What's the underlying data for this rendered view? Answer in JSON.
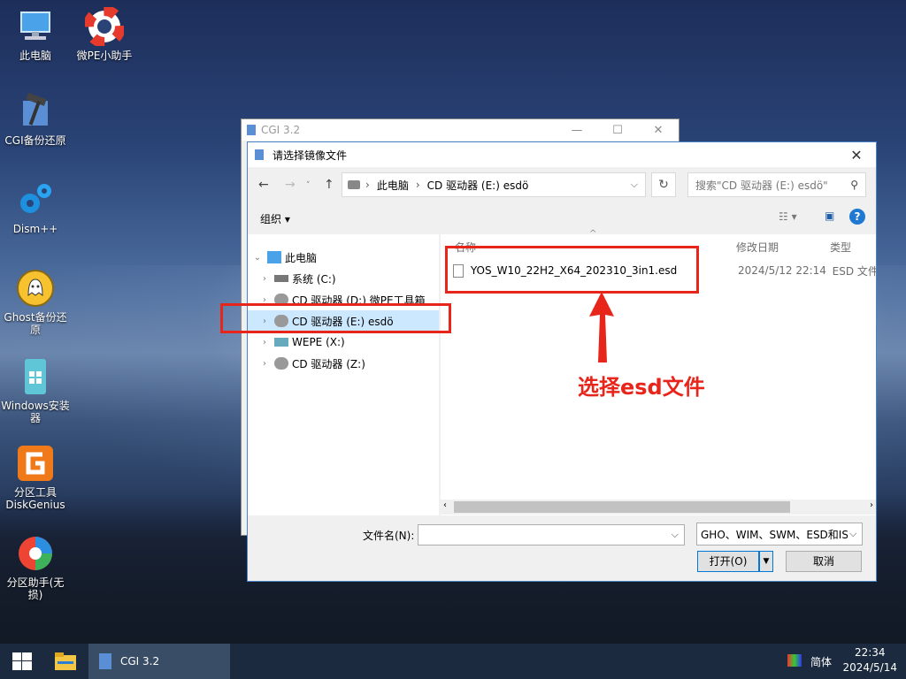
{
  "desktop": {
    "icons": [
      {
        "label": "此电脑",
        "icon": "computer-icon"
      },
      {
        "label": "微PE小助手",
        "icon": "lifebuoy-icon"
      },
      {
        "label": "CGI备份还原",
        "icon": "cgi-hammer-icon"
      },
      {
        "label": "Dism++",
        "icon": "gears-icon"
      },
      {
        "label": "Ghost备份还原",
        "icon": "ghost-icon"
      },
      {
        "label": "Windows安装器",
        "icon": "windows-installer-icon"
      },
      {
        "label": "分区工具DiskGenius",
        "icon": "diskgenius-icon"
      },
      {
        "label": "分区助手(无损)",
        "icon": "partition-assistant-icon"
      }
    ]
  },
  "cgi_window": {
    "title": "CGI 3.2"
  },
  "dialog": {
    "title": "请选择镜像文件",
    "breadcrumb": [
      "此电脑",
      "CD 驱动器 (E:) esdö"
    ],
    "search_placeholder": "搜索\"CD 驱动器 (E:) esdö\"",
    "organize_label": "组织",
    "tree": [
      {
        "label": "此电脑",
        "icon": "computer-icon"
      },
      {
        "label": "系统 (C:)",
        "icon": "drive-icon"
      },
      {
        "label": "CD 驱动器 (D:) 微PE工具箱",
        "icon": "cd-drive-icon"
      },
      {
        "label": "CD 驱动器 (E:) esdö",
        "icon": "cd-drive-icon",
        "selected": true
      },
      {
        "label": "WEPE (X:)",
        "icon": "network-drive-icon"
      },
      {
        "label": "CD 驱动器 (Z:)",
        "icon": "cd-drive-icon"
      }
    ],
    "columns": {
      "name": "名称",
      "modified": "修改日期",
      "type": "类型"
    },
    "files": [
      {
        "name": "YOS_W10_22H2_X64_202310_3in1.esd",
        "modified": "2024/5/12 22:14",
        "type": "ESD 文件"
      }
    ],
    "filename_label": "文件名(N):",
    "filename_value": "",
    "filetype_value": "GHO、WIM、SWM、ESD和ISO",
    "open_label": "打开(O)",
    "cancel_label": "取消"
  },
  "annotation": {
    "text": "选择esd文件",
    "color": "#e8251a"
  },
  "taskbar": {
    "app_label": "CGI 3.2",
    "ime": "简体",
    "time": "22:34",
    "date": "2024/5/14"
  }
}
